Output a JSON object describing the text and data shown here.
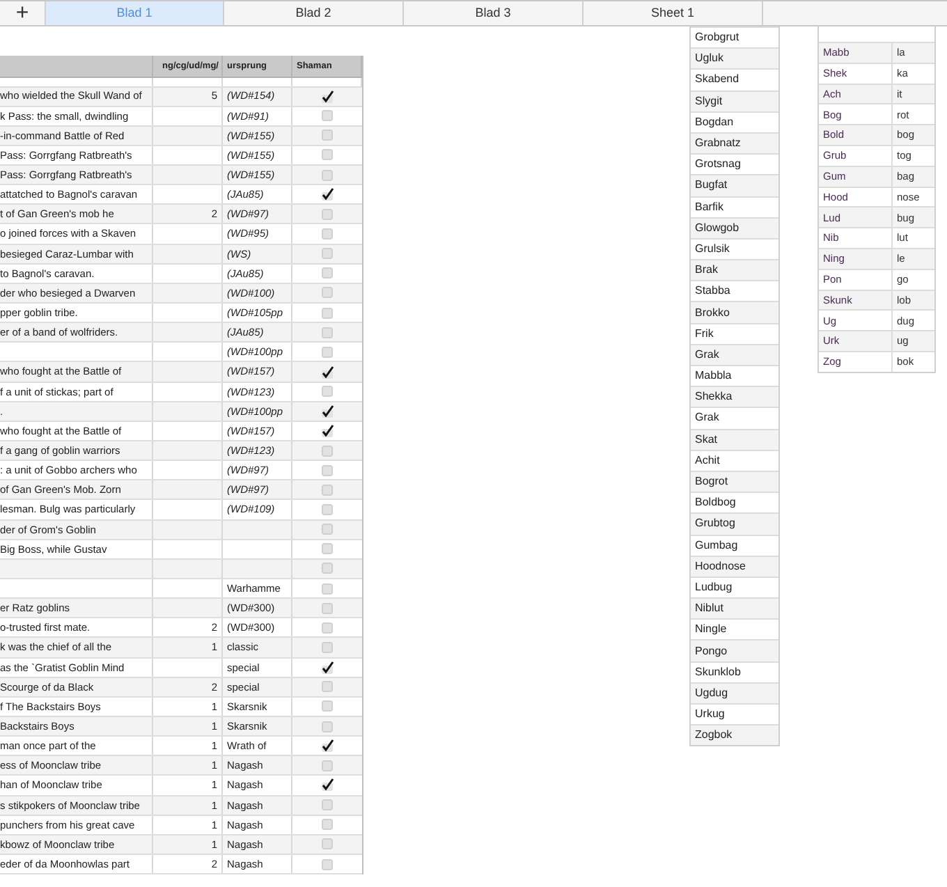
{
  "add_sheet_button": "+",
  "tabs": [
    {
      "label": "Blad 1",
      "selected": true
    },
    {
      "label": "Blad 2",
      "selected": false
    },
    {
      "label": "Blad 3",
      "selected": false
    },
    {
      "label": "Sheet 1",
      "selected": false
    }
  ],
  "main_table": {
    "columns": [
      "",
      "ng/cg/ud/mg/",
      "ursprung",
      "Shaman"
    ],
    "rows": [
      {
        "description": "who wielded the Skull Wand of",
        "count": "5",
        "source": "(WD#154)",
        "italic": true,
        "shaman": true
      },
      {
        "description": "k Pass: the small, dwindling",
        "count": "",
        "source": "(WD#91)",
        "italic": true,
        "shaman": false
      },
      {
        "description": "-in-command Battle of Red",
        "count": "",
        "source": "(WD#155)",
        "italic": true,
        "shaman": false
      },
      {
        "description": "Pass: Gorrgfang Ratbreath's",
        "count": "",
        "source": "(WD#155)",
        "italic": true,
        "shaman": false
      },
      {
        "description": "Pass: Gorrgfang Ratbreath's",
        "count": "",
        "source": "(WD#155)",
        "italic": true,
        "shaman": false
      },
      {
        "description": "attatched to Bagnol's caravan",
        "count": "",
        "source": "(JAu85)",
        "italic": true,
        "shaman": true
      },
      {
        "description": "t of Gan Green's mob he",
        "count": "2",
        "source": "(WD#97)",
        "italic": true,
        "shaman": false
      },
      {
        "description": "o joined forces with a Skaven",
        "count": "",
        "source": "(WD#95)",
        "italic": true,
        "shaman": false
      },
      {
        "description": "besieged Caraz-Lumbar with",
        "count": "",
        "source": "(WS)",
        "italic": true,
        "shaman": false
      },
      {
        "description": "to Bagnol's caravan.",
        "count": "",
        "source": "(JAu85)",
        "italic": true,
        "shaman": false
      },
      {
        "description": "der who besieged a Dwarven",
        "count": "",
        "source": "(WD#100)",
        "italic": true,
        "shaman": false
      },
      {
        "description": "pper goblin tribe.",
        "count": "",
        "source": "(WD#105pp",
        "italic": true,
        "shaman": false
      },
      {
        "description": "er of a band of wolfriders.",
        "count": "",
        "source": "(JAu85)",
        "italic": true,
        "shaman": false
      },
      {
        "description": "",
        "count": "",
        "source": "(WD#100pp",
        "italic": true,
        "shaman": false
      },
      {
        "description": "who fought at the Battle of",
        "count": "",
        "source": "(WD#157)",
        "italic": true,
        "shaman": true
      },
      {
        "description": "f a unit of stickas; part of",
        "count": "",
        "source": "(WD#123)",
        "italic": true,
        "shaman": false
      },
      {
        "description": ".",
        "count": "",
        "source": "(WD#100pp",
        "italic": true,
        "shaman": true
      },
      {
        "description": "who fought at the Battle of",
        "count": "",
        "source": "(WD#157)",
        "italic": true,
        "shaman": true
      },
      {
        "description": "f a gang of goblin warriors",
        "count": "",
        "source": "(WD#123)",
        "italic": true,
        "shaman": false
      },
      {
        "description": ": a unit of Gobbo archers who",
        "count": "",
        "source": "(WD#97)",
        "italic": true,
        "shaman": false
      },
      {
        "description": "of Gan Green's Mob. Zorn",
        "count": "",
        "source": "(WD#97)",
        "italic": true,
        "shaman": false
      },
      {
        "description": "lesman. Bulg was particularly",
        "count": "",
        "source": "(WD#109)",
        "italic": true,
        "shaman": false
      },
      {
        "description": "der of Grom's Goblin",
        "count": "",
        "source": "",
        "shaman": false
      },
      {
        "description": "Big Boss, while Gustav",
        "count": "",
        "source": "",
        "shaman": false
      },
      {
        "description": "",
        "count": "",
        "source": "",
        "shaman": false
      },
      {
        "description": "",
        "count": "",
        "source": "Warhamme",
        "italic": false,
        "shaman": false
      },
      {
        "description": "er Ratz goblins",
        "count": "",
        "source": "(WD#300)",
        "italic": false,
        "shaman": false
      },
      {
        "description": "o-trusted first mate.",
        "count": "2",
        "source": "(WD#300)",
        "italic": false,
        "shaman": false
      },
      {
        "description": "k was the chief of all the",
        "count": "1",
        "source": "classic",
        "italic": false,
        "shaman": false
      },
      {
        "description": "as the `Gratist Goblin Mind",
        "count": "",
        "source": "special",
        "italic": false,
        "shaman": true
      },
      {
        "description": "Scourge of da Black",
        "count": "2",
        "source": "special",
        "italic": false,
        "shaman": false
      },
      {
        "description": "f The Backstairs Boys",
        "count": "1",
        "source": "Skarsnik",
        "italic": false,
        "shaman": false
      },
      {
        "description": "Backstairs Boys",
        "count": "1",
        "source": "Skarsnik",
        "italic": false,
        "shaman": false
      },
      {
        "description": "man once part of the",
        "count": "1",
        "source": "Wrath of",
        "italic": false,
        "shaman": true
      },
      {
        "description": "ess of Moonclaw tribe",
        "count": "1",
        "source": "Nagash",
        "italic": false,
        "shaman": false
      },
      {
        "description": "han of Moonclaw tribe",
        "count": "1",
        "source": "Nagash",
        "italic": false,
        "shaman": true
      },
      {
        "description": "s stikpokers of Moonclaw tribe",
        "count": "1",
        "source": "Nagash",
        "italic": false,
        "shaman": false
      },
      {
        "description": "punchers from his great cave",
        "count": "1",
        "source": "Nagash",
        "italic": false,
        "shaman": false
      },
      {
        "description": "kbowz of Moonclaw tribe",
        "count": "1",
        "source": "Nagash",
        "italic": false,
        "shaman": false
      },
      {
        "description": "eder of da Moonhowlas part",
        "count": "2",
        "source": "Nagash",
        "italic": false,
        "shaman": false
      }
    ]
  },
  "name_list": [
    "Grobgrut",
    "Ugluk",
    "Skabend",
    "Slygit",
    "Bogdan",
    "Grabnatz",
    "Grotsnag",
    "Bugfat",
    "Barfik",
    "Glowgob",
    "Grulsik",
    "Brak",
    "Stabba",
    "Brokko",
    "Frik",
    "Grak",
    "Mabbla",
    "Shekka",
    "Grak",
    "Skat",
    "Achit",
    "Bogrot",
    "Boldbog",
    "Grubtog",
    "Gumbag",
    "Hoodnose",
    "Ludbug",
    "Niblut",
    "Ningle",
    "Pongo",
    "Skunklob",
    "Ugdug",
    "Urkug",
    "Zogbok"
  ],
  "syllable_table": [
    {
      "first": "Mabb",
      "second": "la"
    },
    {
      "first": "Shek",
      "second": "ka"
    },
    {
      "first": "Ach",
      "second": "it"
    },
    {
      "first": "Bog",
      "second": "rot"
    },
    {
      "first": "Bold",
      "second": "bog"
    },
    {
      "first": "Grub",
      "second": "tog"
    },
    {
      "first": "Gum",
      "second": "bag"
    },
    {
      "first": "Hood",
      "second": "nose"
    },
    {
      "first": "Lud",
      "second": "bug"
    },
    {
      "first": "Nib",
      "second": "lut"
    },
    {
      "first": "Ning",
      "second": "le"
    },
    {
      "first": "Pon",
      "second": "go"
    },
    {
      "first": "Skunk",
      "second": "lob"
    },
    {
      "first": "Ug",
      "second": "dug"
    },
    {
      "first": "Urk",
      "second": "ug"
    },
    {
      "first": "Zog",
      "second": "bok"
    }
  ]
}
